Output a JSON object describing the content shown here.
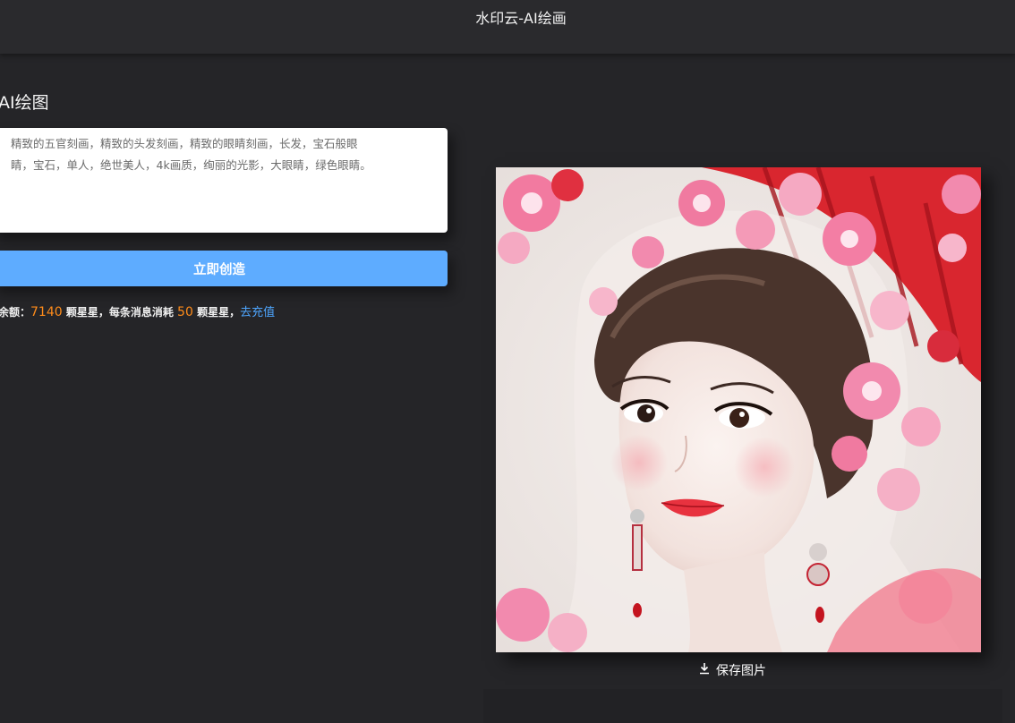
{
  "header": {
    "title": "水印云-AI绘画"
  },
  "main": {
    "heading": "AI绘图",
    "prompt": {
      "value": "精致的五官刻画，精致的头发刻画，精致的眼睛刻画，长发，宝石般眼睛，宝石，单人，绝世美人，4k画质，绚丽的光影，大眼睛，绿色眼睛。"
    },
    "create_button": "立即创造",
    "balance": {
      "prefix": "余额：",
      "amount": "7140",
      "unit1": "颗星星，每条消息消耗",
      "cost": "50",
      "unit2": "颗星星，",
      "recharge_link": "去充值"
    },
    "result": {
      "save_button": "保存图片"
    }
  },
  "colors": {
    "background": "#252528",
    "accent": "#5eacff",
    "highlight_number": "#ff8c1a",
    "link": "#4ea6ff"
  }
}
